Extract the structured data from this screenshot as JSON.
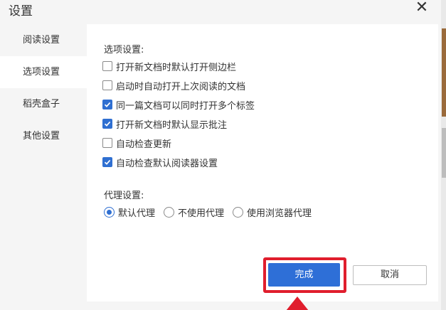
{
  "dialog": {
    "title": "设置",
    "close_glyph": "✕"
  },
  "sidebar": {
    "items": [
      {
        "label": "阅读设置",
        "active": false
      },
      {
        "label": "选项设置",
        "active": true
      },
      {
        "label": "稻壳盒子",
        "active": false
      },
      {
        "label": "其他设置",
        "active": false
      }
    ]
  },
  "options": {
    "section_label": "选项设置:",
    "checkboxes": [
      {
        "label": "打开新文档时默认打开侧边栏",
        "checked": false
      },
      {
        "label": "启动时自动打开上次阅读的文档",
        "checked": false
      },
      {
        "label": "同一篇文档可以同时打开多个标签",
        "checked": true
      },
      {
        "label": "打开新文档时默认显示批注",
        "checked": true
      },
      {
        "label": "自动检查更新",
        "checked": false
      },
      {
        "label": "自动检查默认阅读器设置",
        "checked": true
      }
    ]
  },
  "proxy": {
    "section_label": "代理设置:",
    "options": [
      {
        "label": "默认代理",
        "selected": true
      },
      {
        "label": "不使用代理",
        "selected": false
      },
      {
        "label": "使用浏览器代理",
        "selected": false
      }
    ]
  },
  "buttons": {
    "ok_label": "完成",
    "cancel_label": "取消"
  },
  "colors": {
    "accent": "#2f6fd1",
    "highlight": "#e01e2d"
  },
  "icons": {
    "close": "close-icon",
    "checkmark": "check-icon",
    "pointer_arrow": "arrow-up-icon"
  }
}
